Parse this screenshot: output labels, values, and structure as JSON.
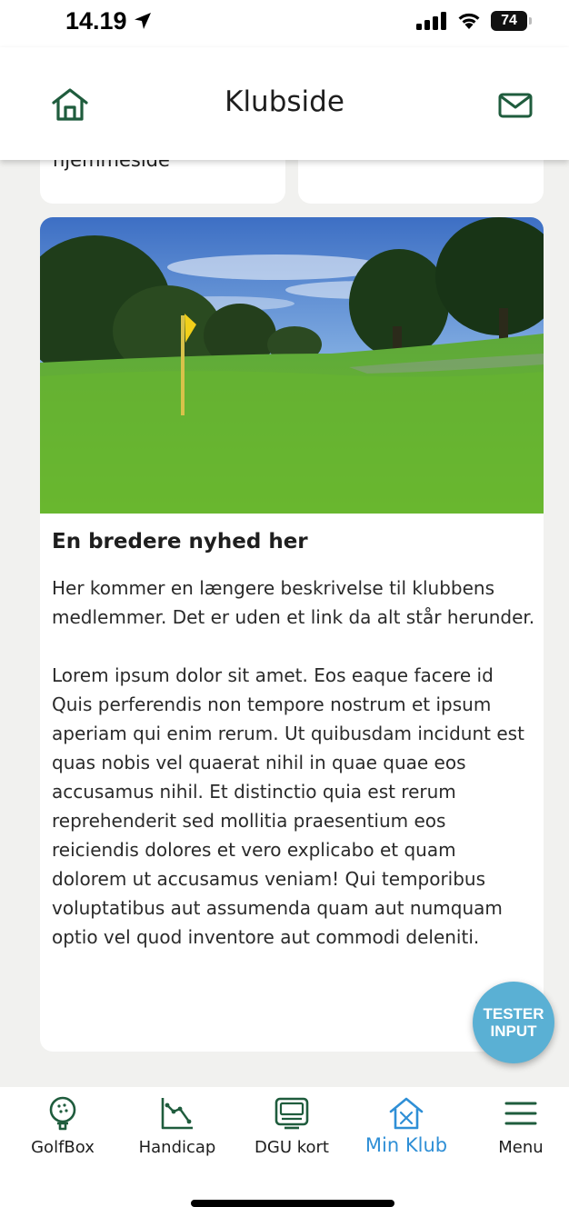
{
  "status_bar": {
    "time": "14.19",
    "battery": "74"
  },
  "header": {
    "title": "Klubside"
  },
  "cards": {
    "top_left_text": "hjemmeside"
  },
  "news": {
    "title": "En bredere nyhed her",
    "body": "Her kommer en længere beskrivelse til klubbens medlemmer. Det er uden et link da alt står herunder.\n\nLorem ipsum dolor sit amet. Eos eaque facere id Quis perferendis non tempore nostrum et ipsum aperiam qui enim rerum. Ut quibusdam incidunt est quas nobis vel quaerat nihil in quae quae eos accusamus nihil. Et distinctio quia est rerum reprehenderit sed mollitia praesentium eos reiciendis dolores et vero explicabo et quam dolorem ut accusamus veniam! Qui temporibus voluptatibus aut assumenda quam aut numquam optio vel quod inventore aut commodi deleniti."
  },
  "fab": {
    "line1": "TESTER",
    "line2": "INPUT"
  },
  "tab_bar": {
    "items": [
      {
        "label": "GolfBox",
        "icon": "golf-ball-icon"
      },
      {
        "label": "Handicap",
        "icon": "handicap-chart-icon"
      },
      {
        "label": "DGU kort",
        "icon": "card-icon"
      },
      {
        "label": "Min Klub",
        "icon": "club-house-icon",
        "active": true
      },
      {
        "label": "Menu",
        "icon": "hamburger-icon"
      }
    ]
  },
  "colors": {
    "brand_green": "#1f5c3d",
    "active_blue": "#2f8fd6",
    "fab_blue": "#5ab0d4",
    "background": "#f1f1ef"
  }
}
